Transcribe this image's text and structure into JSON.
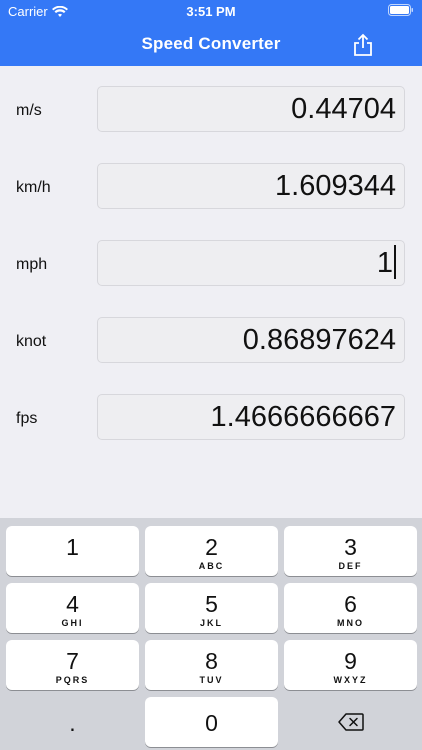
{
  "status_bar": {
    "carrier": "Carrier",
    "time": "3:51 PM"
  },
  "header": {
    "title": "Speed Converter",
    "share_icon": "share-icon"
  },
  "colors": {
    "accent": "#3478f6",
    "background": "#efeff4",
    "keyboard": "#d1d3d9"
  },
  "units": [
    {
      "label": "m/s",
      "value": "0.44704"
    },
    {
      "label": "km/h",
      "value": "1.609344"
    },
    {
      "label": "mph",
      "value": "1"
    },
    {
      "label": "knot",
      "value": "0.86897624"
    },
    {
      "label": "fps",
      "value": "1.4666666667"
    }
  ],
  "keypad": [
    {
      "digit": "1",
      "letters": ""
    },
    {
      "digit": "2",
      "letters": "ABC"
    },
    {
      "digit": "3",
      "letters": "DEF"
    },
    {
      "digit": "4",
      "letters": "GHI"
    },
    {
      "digit": "5",
      "letters": "JKL"
    },
    {
      "digit": "6",
      "letters": "MNO"
    },
    {
      "digit": "7",
      "letters": "PQRS"
    },
    {
      "digit": "8",
      "letters": "TUV"
    },
    {
      "digit": "9",
      "letters": "WXYZ"
    },
    {
      "digit": ".",
      "letters": ""
    },
    {
      "digit": "0",
      "letters": ""
    },
    {
      "digit": "",
      "letters": "",
      "icon": "backspace-icon"
    }
  ]
}
